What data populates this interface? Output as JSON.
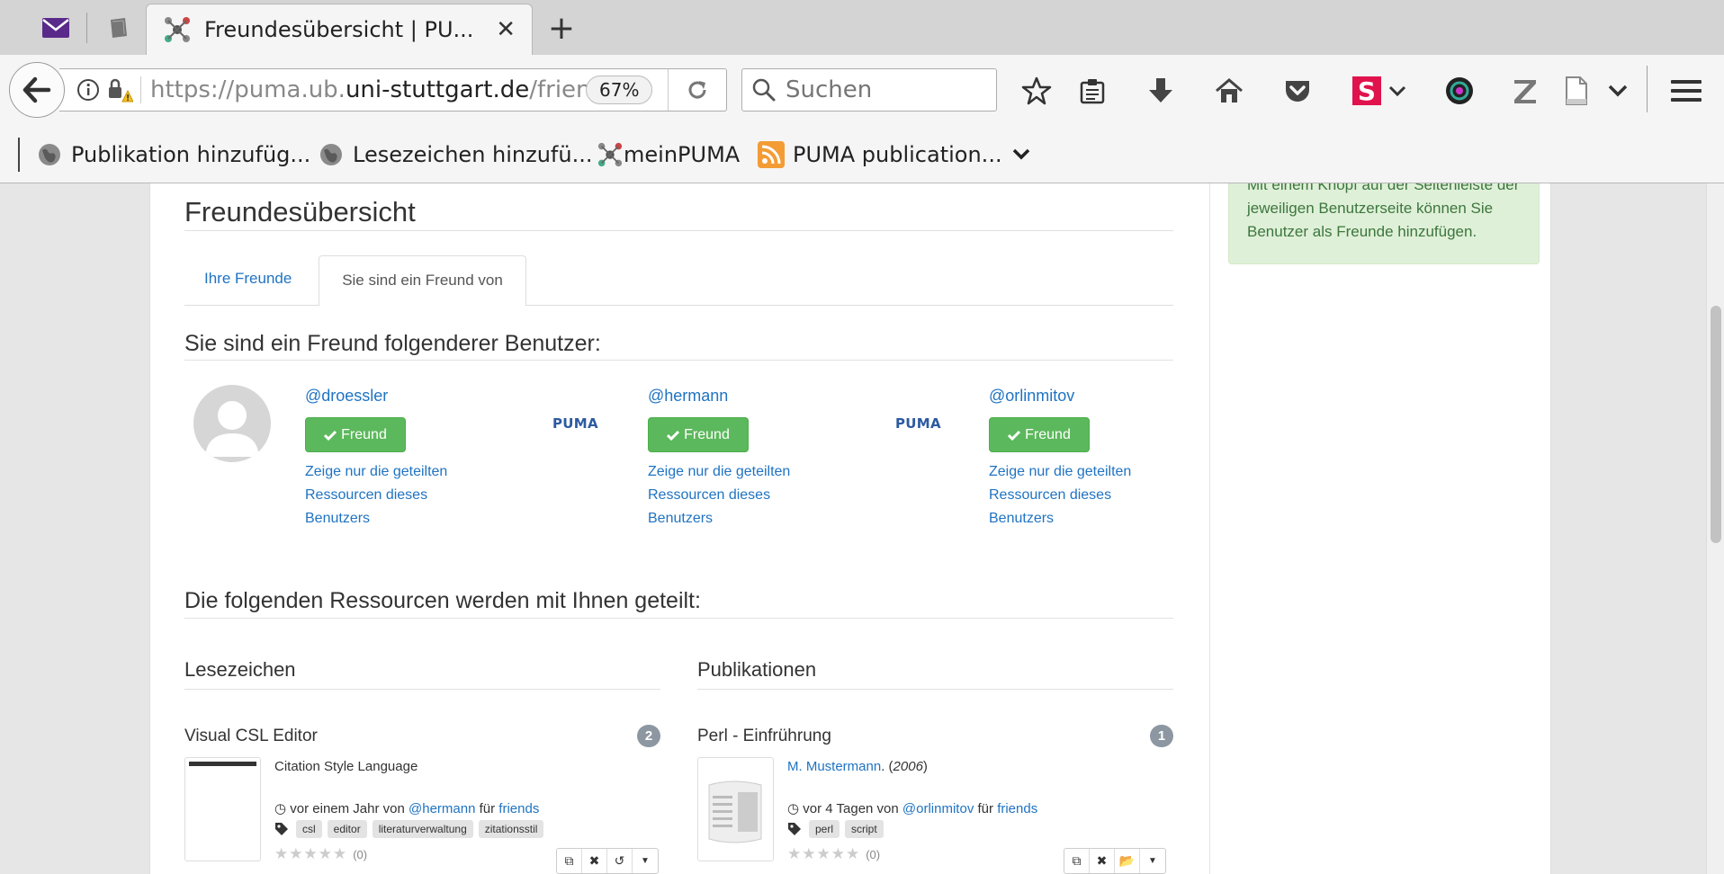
{
  "browser": {
    "tab_title": "Freundesübersicht | PU...",
    "url_prefix": "https://puma.ub.",
    "url_domain": "uni-stuttgart.de",
    "url_suffix": "/frien",
    "zoom": "67%",
    "search_placeholder": "Suchen",
    "bookmarks": [
      {
        "label": "Publikation hinzufüg...",
        "icon": "globe-icon"
      },
      {
        "label": "Lesezeichen hinzufü...",
        "icon": "globe-icon"
      },
      {
        "label": "meinPUMA",
        "icon": "puma-favicon"
      },
      {
        "label": "PUMA publication...",
        "icon": "rss-icon"
      }
    ],
    "colors": {
      "rss": "#f39c34",
      "accent_pink": "#e0134d"
    }
  },
  "sidebar": {
    "alert_text": "Mit einem Knopf auf der Seitenleiste der jeweiligen Benutzerseite können Sie Benutzer als Freunde hinzufügen."
  },
  "main": {
    "title": "Freundesübersicht",
    "tabs": [
      {
        "label": "Ihre Freunde",
        "active": false
      },
      {
        "label": "Sie sind ein Freund von",
        "active": true
      }
    ],
    "friends_heading": "Sie sind ein Freund folgenderer Benutzer:",
    "friends": [
      {
        "username": "@droessler",
        "button": "Freund",
        "link": "Zeige nur die geteilten Ressourcen dieses Benutzers",
        "avatar": "default-avatar"
      },
      {
        "username": "@hermann",
        "button": "Freund",
        "link": "Zeige nur die geteilten Ressourcen dieses Benutzers",
        "avatar": "PUMA"
      },
      {
        "username": "@orlinmitov",
        "button": "Freund",
        "link": "Zeige nur die geteilten Ressourcen dieses Benutzers",
        "avatar": "PUMA"
      }
    ],
    "shared_heading": "Die folgenden Ressourcen werden mit Ihnen geteilt:",
    "bookmarks_heading": "Lesezeichen",
    "publications_heading": "Publikationen",
    "bookmark_post": {
      "title": "Visual CSL Editor",
      "count": "2",
      "description": "Citation Style Language",
      "time": "vor einem Jahr von",
      "user": "@hermann",
      "for_word": "für",
      "group": "friends",
      "tags": [
        "csl",
        "editor",
        "literaturverwaltung",
        "zitationsstil"
      ],
      "rating": "(0)"
    },
    "publication_post": {
      "title": "Perl - Einfrührung",
      "count": "1",
      "author": "M. Mustermann",
      "year": "2006",
      "time": "vor 4 Tagen von",
      "user": "@orlinmitov",
      "for_word": "für",
      "group": "friends",
      "tags": [
        "perl",
        "script"
      ],
      "rating": "(0)"
    },
    "colors": {
      "link": "#1f73c2",
      "success": "#5cb85c",
      "alert_bg": "#dff0d8",
      "alert_text": "#3c763d",
      "badge": "#8d97a2"
    }
  }
}
